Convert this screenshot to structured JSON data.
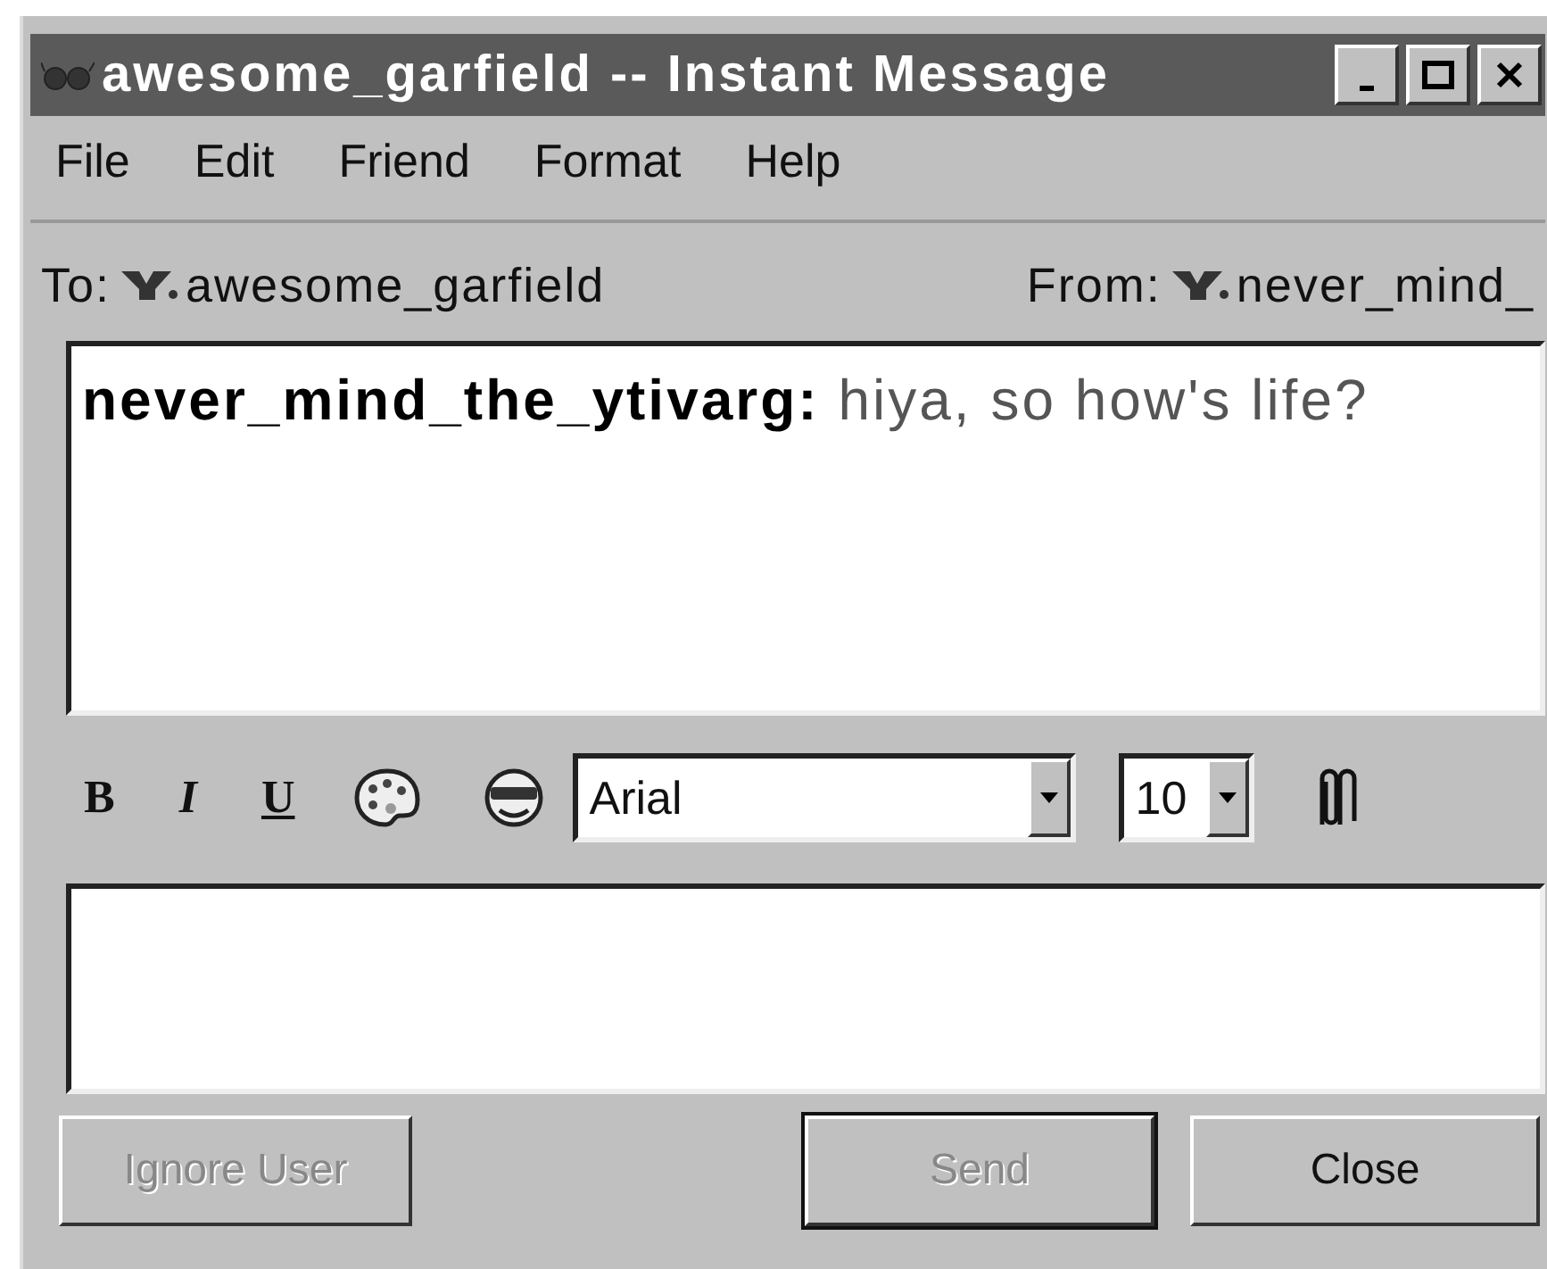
{
  "window": {
    "title": "awesome_garfield -- Instant Message"
  },
  "menu": [
    {
      "label": "File"
    },
    {
      "label": "Edit"
    },
    {
      "label": "Friend"
    },
    {
      "label": "Format"
    },
    {
      "label": "Help"
    }
  ],
  "to": {
    "label": "To:",
    "name": "awesome_garfield"
  },
  "from": {
    "label": "From:",
    "name": "never_mind_"
  },
  "messages": [
    {
      "text": "**never_mind_the_ytivarg:** hiya, so how's life?"
    }
  ],
  "toolbar": {
    "bold": "B",
    "italic": "I",
    "underline": "U",
    "font": "Arial",
    "size": "10"
  },
  "buttons": [
    {
      "label": "Ignore User",
      "disabled": true,
      "default": false
    },
    {
      "label": "Send",
      "disabled": true,
      "default": true
    },
    {
      "label": "Close",
      "disabled": false,
      "default": false
    }
  ]
}
